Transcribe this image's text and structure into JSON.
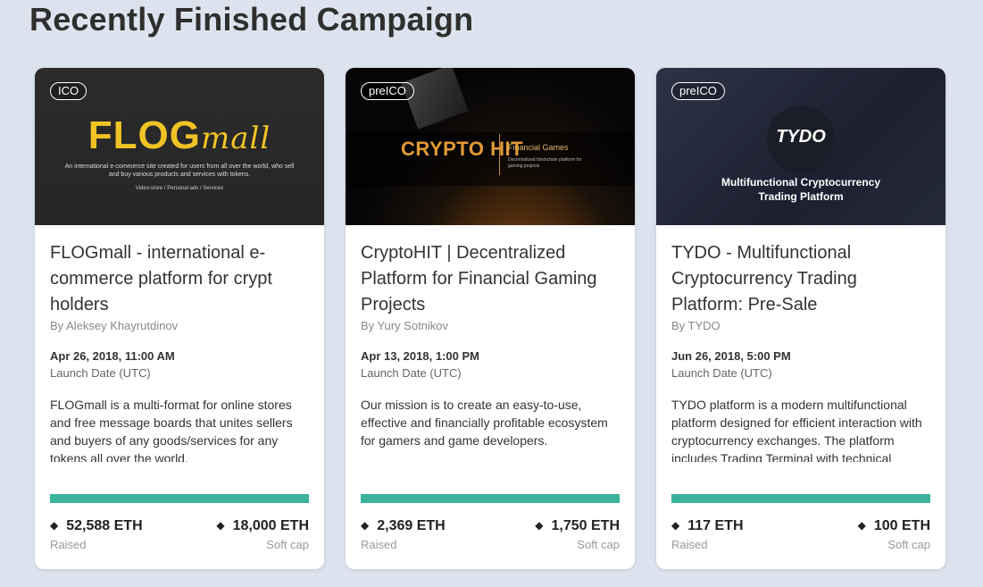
{
  "section_title": "Recently Finished Campaign",
  "accent_color": "#3bb39c",
  "campaigns": [
    {
      "badge": "ICO",
      "banner": {
        "logo": "FLOG",
        "logo_suffix": "mall",
        "tagline": "An international e-commerce site created for users from all over the world, who sell and buy various products and services with tokens.",
        "links": "Video-store  /  Personal ads  /  Services"
      },
      "title": "FLOGmall - international e-commerce platform for crypt holders",
      "author": "By Aleksey Khayrutdinov",
      "date": "Apr 26, 2018, 11:00 AM",
      "date_label": "Launch Date (UTC)",
      "description": "FLOGmall is a multi-format for online stores and free message boards that unites sellers and buyers of any goods/services for any tokens all over the world.",
      "progress": 1.0,
      "raised": "52,588 ETH",
      "raised_label": "Raised",
      "softcap": "18,000 ETH",
      "softcap_label": "Soft cap"
    },
    {
      "badge": "preICO",
      "banner": {
        "logo": "CRYPTO HIT",
        "heading": "Financial Games",
        "sub": "Decentralized blockchain platform for gaming projects"
      },
      "title": "CryptoHIT | Decentralized Platform for Financial Gaming Projects",
      "author": "By Yury Sotnikov",
      "date": "Apr 13, 2018, 1:00 PM",
      "date_label": "Launch Date (UTC)",
      "description": "Our mission is to create an easy-to-use, effective and financially profitable ecosystem for gamers and game developers.",
      "progress": 1.0,
      "raised": "2,369 ETH",
      "raised_label": "Raised",
      "softcap": "1,750 ETH",
      "softcap_label": "Soft cap"
    },
    {
      "badge": "preICO",
      "banner": {
        "logo": "TYDO",
        "line1": "Multifunctional Cryptocurrency",
        "line2": "Trading Platform"
      },
      "title": "TYDO - Multifunctional Cryptocurrency Trading Platform: Pre-Sale",
      "author": "By TYDO",
      "date": "Jun 26, 2018, 5:00 PM",
      "date_label": "Launch Date (UTC)",
      "description": "TYDO platform is a modern multifunctional platform designed for efficient interaction with cryptocurrency exchanges. The platform includes Trading Terminal with technical analysis tools, Marketplace.",
      "progress": 1.0,
      "raised": "117 ETH",
      "raised_label": "Raised",
      "softcap": "100 ETH",
      "softcap_label": "Soft cap"
    }
  ]
}
